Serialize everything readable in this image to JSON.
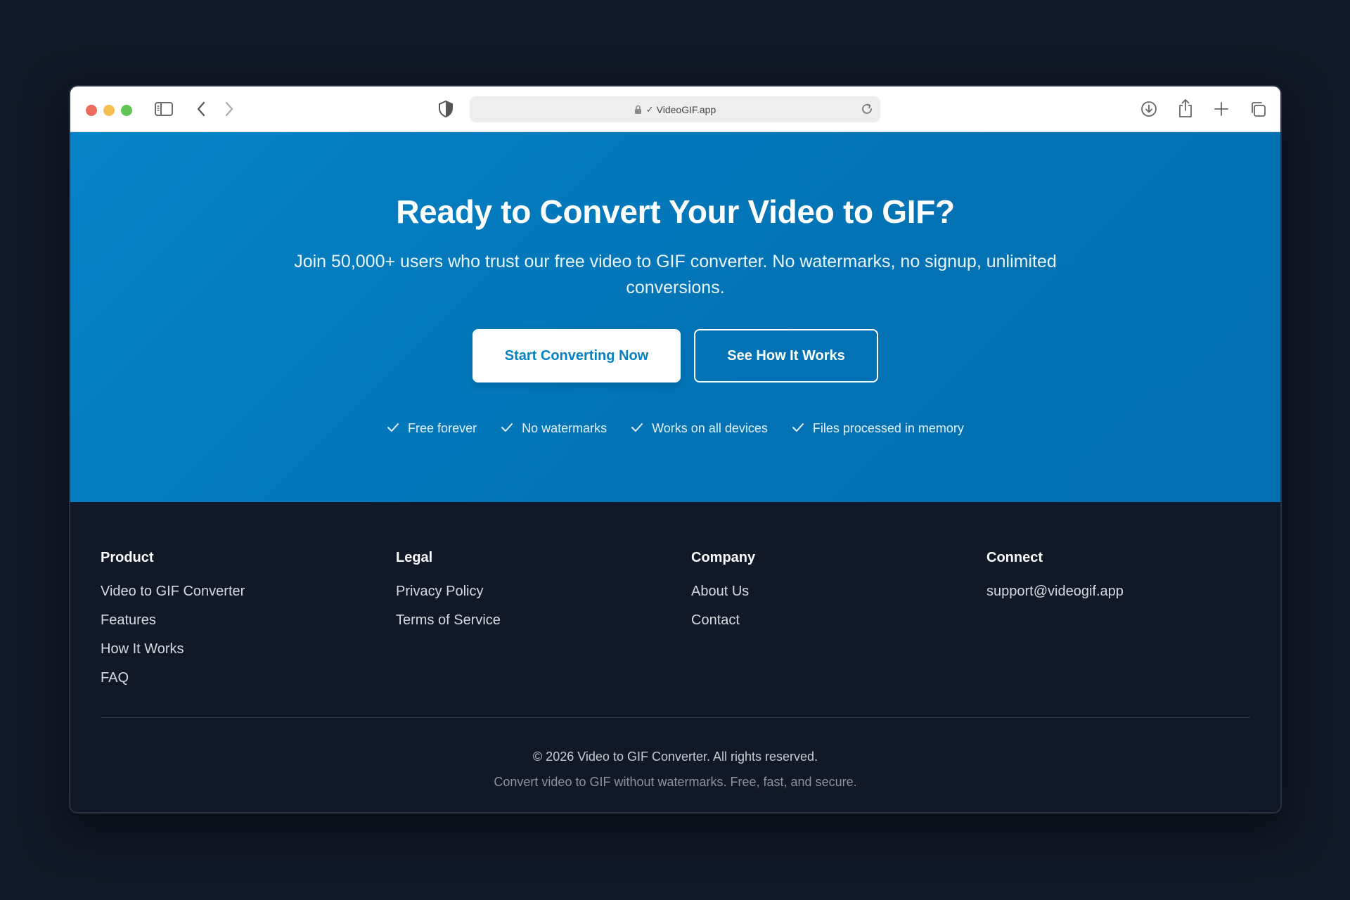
{
  "browser": {
    "address": "VideoGIF.app",
    "address_check": "✓"
  },
  "hero": {
    "title": "Ready to Convert Your Video to GIF?",
    "subtitle": "Join 50,000+ users who trust our free video to GIF converter. No watermarks, no signup, unlimited conversions.",
    "primary_button": "Start Converting Now",
    "secondary_button": "See How It Works",
    "features": [
      "Free forever",
      "No watermarks",
      "Works on all devices",
      "Files processed in memory"
    ]
  },
  "footer": {
    "columns": [
      {
        "heading": "Product",
        "links": [
          "Video to GIF Converter",
          "Features",
          "How It Works",
          "FAQ"
        ]
      },
      {
        "heading": "Legal",
        "links": [
          "Privacy Policy",
          "Terms of Service"
        ]
      },
      {
        "heading": "Company",
        "links": [
          "About Us",
          "Contact"
        ]
      },
      {
        "heading": "Connect",
        "links": [
          "support@videogif.app"
        ]
      }
    ],
    "copyright": "© 2026 Video to GIF Converter. All rights reserved.",
    "tagline": "Convert video to GIF without watermarks. Free, fast, and secure."
  },
  "colors": {
    "page_background": "#111827",
    "hero_blue": "#0584c7",
    "primary_button_text": "#0681c4",
    "footer_background": "#111827"
  },
  "icons": {
    "toolbar": [
      "sidebar-icon",
      "back-chevron-icon",
      "forward-chevron-icon",
      "shield-icon",
      "lock-icon",
      "reload-icon",
      "download-icon",
      "share-icon",
      "new-tab-plus-icon",
      "tabs-overview-icon"
    ],
    "feature": "checkmark-icon"
  }
}
